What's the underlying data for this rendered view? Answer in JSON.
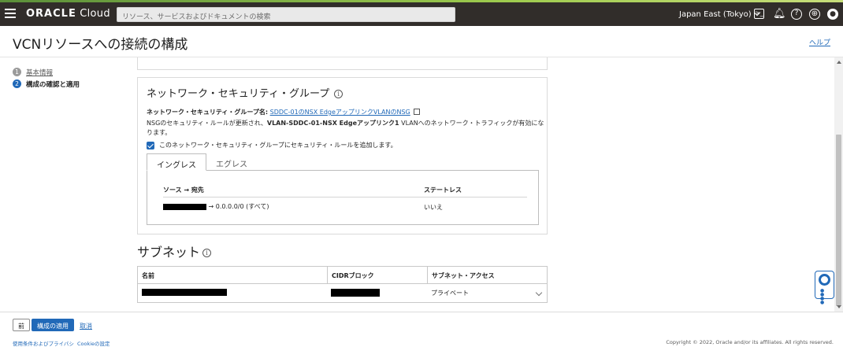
{
  "topbar": {
    "brand": "ORACLE",
    "brand_suffix": " Cloud",
    "search_placeholder": "リソース、サービスおよびドキュメントの検索",
    "region": "Japan East (Tokyo)",
    "icons": [
      "cloud-shell-icon",
      "bell-icon",
      "help-icon",
      "globe-icon",
      "user-icon"
    ]
  },
  "header": {
    "title": "VCNリソースへの接続の構成",
    "help_link": "ヘルプ"
  },
  "steps": [
    {
      "num": "1",
      "label": "基本情報"
    },
    {
      "num": "2",
      "label": "構成の確認と適用"
    }
  ],
  "nsg": {
    "title": "ネットワーク・セキュリティ・グループ",
    "info_glyph": "i",
    "name_label": "ネットワーク・セキュリティ・グループ名:",
    "name_link": "SDDC-01のNSX EdgeアップリンクVLANのNSG",
    "desc_prefix": "NSGのセキュリティ・ルールが更新され、",
    "desc_bold": "VLAN-SDDC-01-NSX Edgeアップリンク1",
    "desc_suffix": " VLANへのネットワーク・トラフィックが有効になります。",
    "checkbox_label": "このネットワーク・セキュリティ・グループにセキュリティ・ルールを追加します。",
    "checkbox_checked": true,
    "tabs": [
      "イングレス",
      "エグレス"
    ],
    "active_tab": "イングレス",
    "rule_columns": [
      "ソース → 宛先",
      "ステートレス"
    ],
    "rules": [
      {
        "dest": "→ 0.0.0.0/0 (すべて)",
        "stateless": "いいえ"
      }
    ]
  },
  "subnet": {
    "title": "サブネット",
    "info_glyph": "i",
    "columns": [
      "名前",
      "CIDRブロック",
      "サブネット・アクセス"
    ],
    "rows": [
      {
        "access": "プライベート"
      }
    ]
  },
  "footer": {
    "prev_button": "前",
    "apply_button": "構成の適用",
    "cancel_link": "取消"
  },
  "legal": {
    "terms": "使用条件およびプライバシ",
    "cookie": "Cookieの設定",
    "copyright": "Copyright © 2022, Oracle and/or its affiliates. All rights reserved."
  },
  "colors": {
    "accent": "#2169b8",
    "topbar": "#312d2a"
  }
}
